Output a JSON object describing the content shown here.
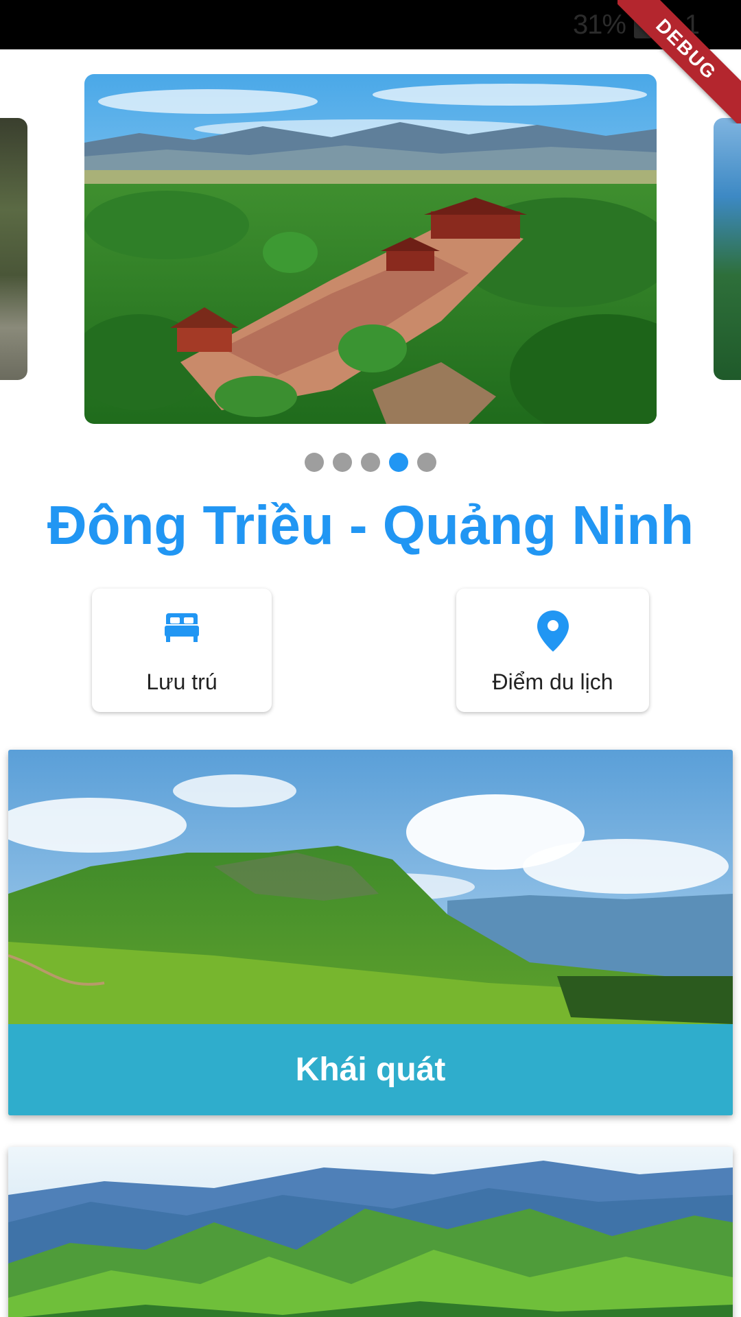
{
  "status_bar": {
    "battery_percent": "31%",
    "clock": "1"
  },
  "debug_banner": {
    "label": "DEBUG"
  },
  "carousel": {
    "dot_count": 5,
    "active_index": 3
  },
  "page_title": "Đông Triều - Quảng Ninh",
  "actions": [
    {
      "label": "Lưu trú",
      "icon": "bed-icon"
    },
    {
      "label": "Điểm du lịch",
      "icon": "location-pin-icon"
    }
  ],
  "feature_cards": [
    {
      "label": "Khái quát"
    }
  ],
  "colors": {
    "accent": "#2196f3",
    "overlay": "#26ace2",
    "ribbon": "#b4262e",
    "dot_inactive": "#9e9e9e"
  }
}
